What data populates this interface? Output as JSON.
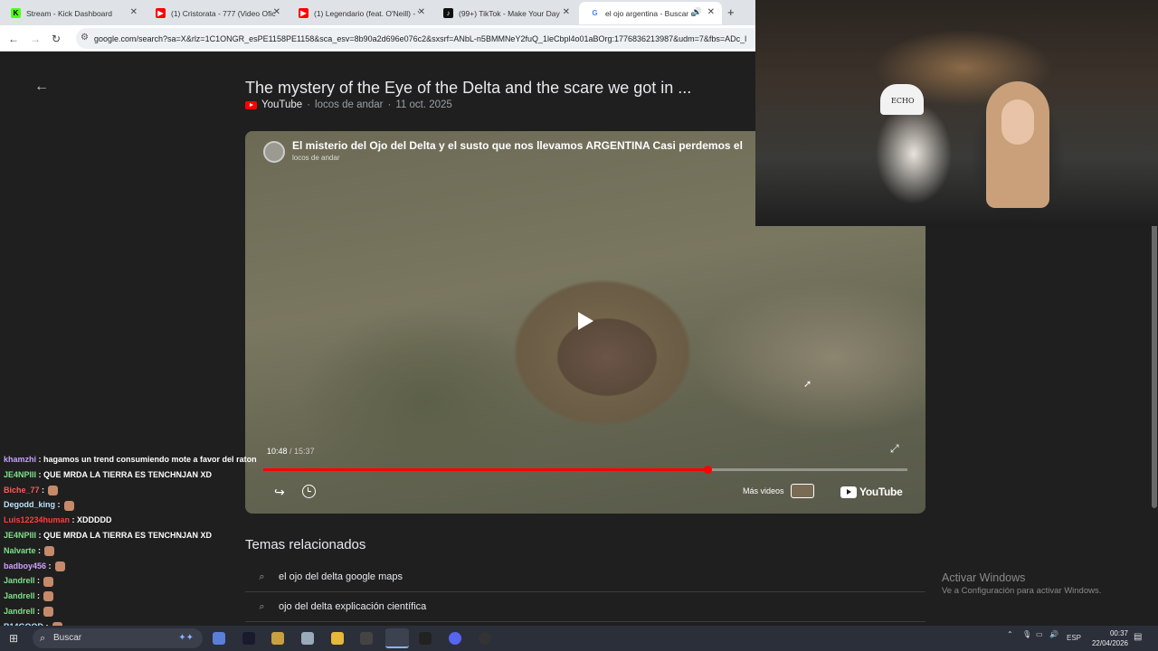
{
  "tabs": [
    {
      "title": "Stream - Kick Dashboard",
      "color": "#53fc18",
      "letter": "K"
    },
    {
      "title": "(1) Cristorata - 777 (Video Ofici...",
      "color": "#ff0000",
      "letter": "▶"
    },
    {
      "title": "(1) Legendario (feat. O'Neill) - Y",
      "color": "#ff0000",
      "letter": "▶"
    },
    {
      "title": "(99+) TikTok - Make Your Day",
      "color": "#111111",
      "letter": "♪"
    },
    {
      "title": "el ojo argentina - Buscar co",
      "color": "#4285f4",
      "letter": "G"
    }
  ],
  "address": {
    "url": "google.com/search?sa=X&rlz=1C1ONGR_esPE1158PE1158&sca_esv=8b90a2d696e076c2&sxsrf=ANbL-n5BMMNeY2fuQ_1leCbpl4o01aBOrg:1776836213987&udm=7&fbs=ADc_l"
  },
  "result": {
    "title": "The mystery of the Eye of the Delta and the scare we got in ...",
    "source": "YouTube",
    "channel": "locos de andar",
    "date": "11 oct. 2025"
  },
  "player": {
    "video_title": "El misterio del Ojo del Delta y el susto que nos llevamos ARGENTINA Casi perdemos el",
    "channel": "locos de andar",
    "current_time": "10:48",
    "duration": "15:37",
    "progress": 0.69,
    "more_videos": "Más videos",
    "logo": "YouTube"
  },
  "related": {
    "heading": "Temas relacionados",
    "items": [
      "el ojo del delta google maps",
      "ojo del delta explicación científica"
    ]
  },
  "activate": {
    "title": "Activar Windows",
    "sub": "Ve a Configuración para activar Windows."
  },
  "webcam": {
    "cap_text": "ECHO"
  },
  "chat": [
    {
      "user": "khamzhi",
      "color": "#c8a0ff",
      "msg": ": hagamos un trend consumiendo mote a favor del raton",
      "emote": false
    },
    {
      "user": "JE4NPIII",
      "color": "#7fe08a",
      "msg": ": QUE MRDA LA TIERRA ES TENCHNJAN XD",
      "emote": false
    },
    {
      "user": "Biche_77",
      "color": "#ff5a5a",
      "msg": ":",
      "emote": true
    },
    {
      "user": "Degodd_king",
      "color": "#b9e3ff",
      "msg": ":",
      "emote": true
    },
    {
      "user": "Luis12234human",
      "color": "#ff3c3c",
      "msg": ": XDDDDD",
      "emote": false
    },
    {
      "user": "JE4NPIII",
      "color": "#7fe08a",
      "msg": ": QUE MRDA LA TIERRA ES TENCHNJAN XD",
      "emote": false
    },
    {
      "user": "Nalvarte",
      "color": "#7fe08a",
      "msg": ":",
      "emote": true
    },
    {
      "user": "badboy456",
      "color": "#d0a0ff",
      "msg": ":",
      "emote": true
    },
    {
      "user": "Jandrell",
      "color": "#7fe08a",
      "msg": ":",
      "emote": true
    },
    {
      "user": "Jandrell",
      "color": "#7fe08a",
      "msg": ":",
      "emote": true
    },
    {
      "user": "Jandrell",
      "color": "#7fe08a",
      "msg": ":",
      "emote": true
    },
    {
      "user": "B14GOOD",
      "color": "#b9e3ff",
      "msg": ":",
      "emote": true
    }
  ],
  "taskbar": {
    "search": "Buscar",
    "lang": "ESP",
    "time": "00:37",
    "date": "22/04/2026"
  }
}
